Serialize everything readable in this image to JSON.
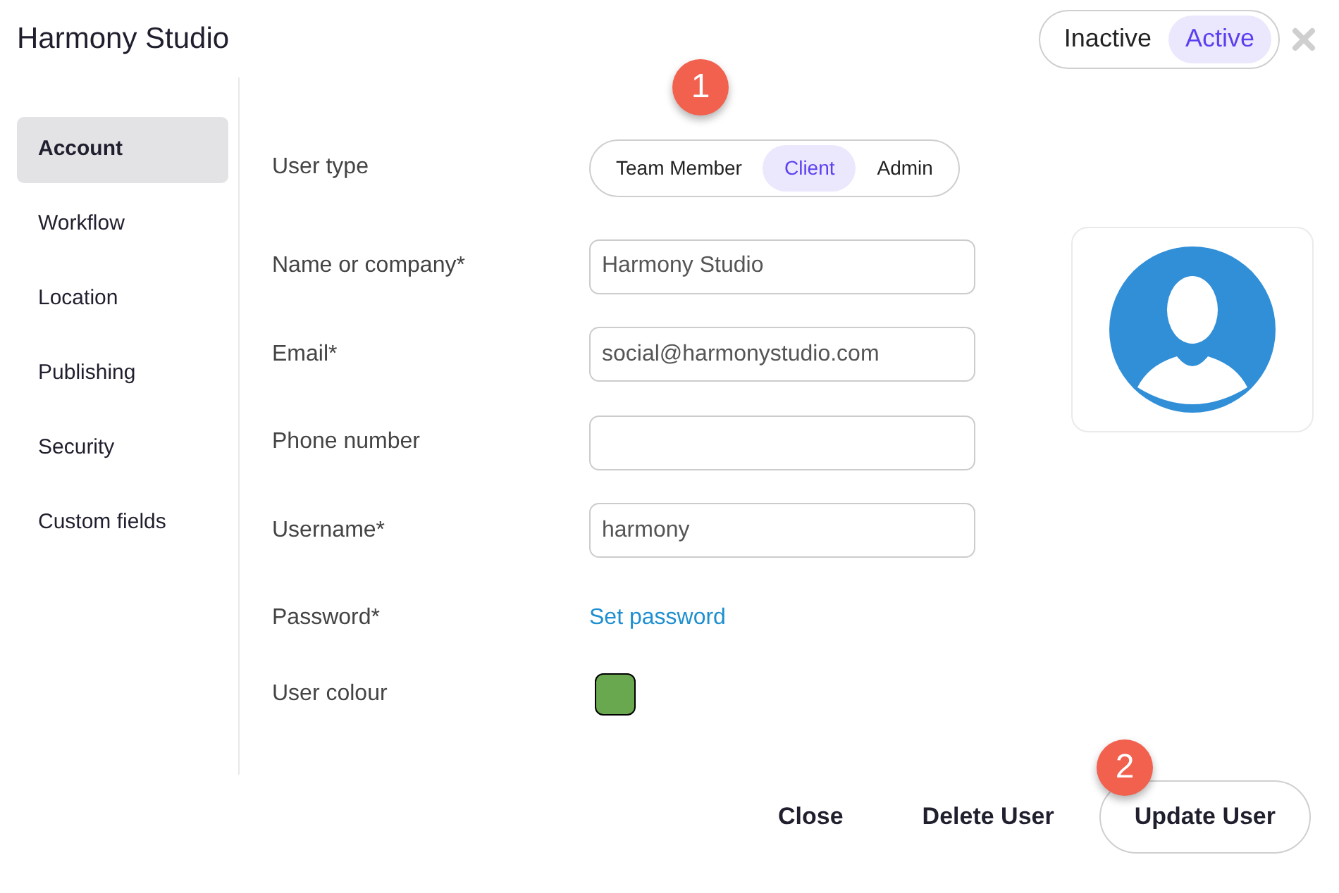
{
  "window": {
    "title": "Harmony Studio"
  },
  "status_toggle": [
    {
      "label": "Inactive",
      "selected": false
    },
    {
      "label": "Active",
      "selected": true
    }
  ],
  "sidebar": {
    "items": [
      {
        "label": "Account",
        "selected": true
      },
      {
        "label": "Workflow",
        "selected": false
      },
      {
        "label": "Location",
        "selected": false
      },
      {
        "label": "Publishing",
        "selected": false
      },
      {
        "label": "Security",
        "selected": false
      },
      {
        "label": "Custom fields",
        "selected": false
      }
    ]
  },
  "form": [
    {
      "kind": "segmented",
      "label": "User type",
      "options": [
        {
          "label": "Team Member",
          "selected": false
        },
        {
          "label": "Client",
          "selected": true
        },
        {
          "label": "Admin",
          "selected": false
        }
      ]
    },
    {
      "kind": "text",
      "label": "Name or company*",
      "value": "Harmony Studio"
    },
    {
      "kind": "text",
      "label": "Email*",
      "value": "social@harmonystudio.com"
    },
    {
      "kind": "text",
      "label": "Phone number"
    },
    {
      "kind": "text",
      "label": "Username*",
      "value": "harmony"
    },
    {
      "kind": "link",
      "label": "Password*",
      "link": "Set password"
    },
    {
      "kind": "color",
      "label": "User colour",
      "color": "#6aa84f"
    }
  ],
  "callouts": [
    "1",
    "2"
  ],
  "footer": {
    "buttons": [
      {
        "label": "Close",
        "kind": "plain"
      },
      {
        "label": "Delete User",
        "kind": "plain"
      },
      {
        "label": "Update User",
        "kind": "outlined"
      }
    ]
  }
}
